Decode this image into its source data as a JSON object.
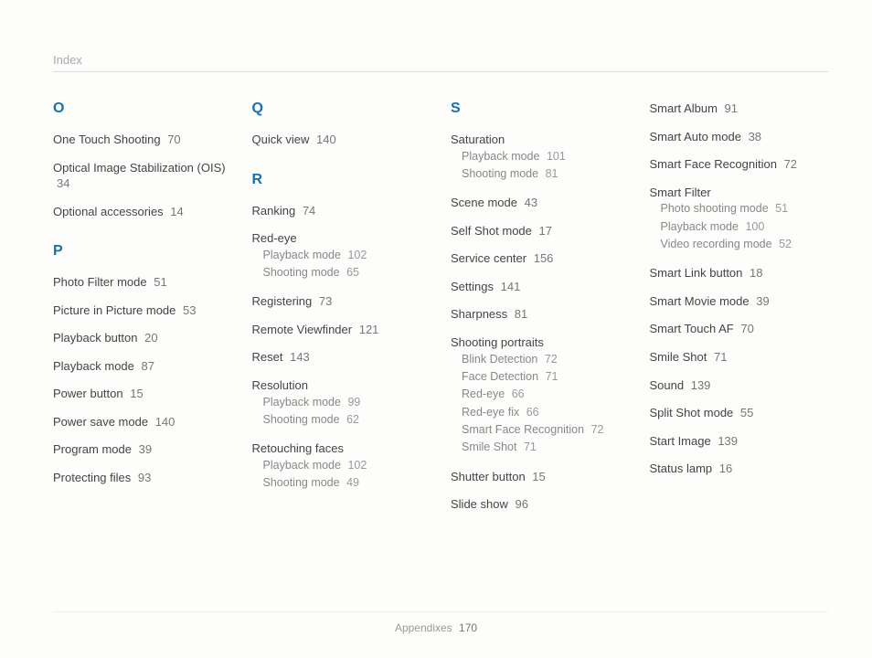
{
  "header": "Index",
  "footer": {
    "section": "Appendixes",
    "page": "170"
  },
  "columns": [
    {
      "groups": [
        {
          "letter": "O",
          "spaced": false,
          "entries": [
            {
              "term": "One Touch Shooting",
              "page": "70"
            },
            {
              "term": "Optical Image Stabilization (OIS)",
              "page": "34"
            },
            {
              "term": "Optional accessories",
              "page": "14"
            }
          ]
        },
        {
          "letter": "P",
          "spaced": true,
          "entries": [
            {
              "term": "Photo Filter mode",
              "page": "51"
            },
            {
              "term": "Picture in Picture mode",
              "page": "53"
            },
            {
              "term": "Playback button",
              "page": "20"
            },
            {
              "term": "Playback mode",
              "page": "87"
            },
            {
              "term": "Power button",
              "page": "15"
            },
            {
              "term": "Power save mode",
              "page": "140"
            },
            {
              "term": "Program mode",
              "page": "39"
            },
            {
              "term": "Protecting files",
              "page": "93"
            }
          ]
        }
      ]
    },
    {
      "groups": [
        {
          "letter": "Q",
          "spaced": false,
          "entries": [
            {
              "term": "Quick view",
              "page": "140"
            }
          ]
        },
        {
          "letter": "R",
          "spaced": true,
          "entries": [
            {
              "term": "Ranking",
              "page": "74"
            },
            {
              "term": "Red-eye",
              "subs": [
                {
                  "term": "Playback mode",
                  "page": "102"
                },
                {
                  "term": "Shooting mode",
                  "page": "65"
                }
              ]
            },
            {
              "term": "Registering",
              "page": "73"
            },
            {
              "term": "Remote Viewfinder",
              "page": "121"
            },
            {
              "term": "Reset",
              "page": "143"
            },
            {
              "term": "Resolution",
              "subs": [
                {
                  "term": "Playback mode",
                  "page": "99"
                },
                {
                  "term": "Shooting mode",
                  "page": "62"
                }
              ]
            },
            {
              "term": "Retouching faces",
              "subs": [
                {
                  "term": "Playback mode",
                  "page": "102"
                },
                {
                  "term": "Shooting mode",
                  "page": "49"
                }
              ]
            }
          ]
        }
      ]
    },
    {
      "groups": [
        {
          "letter": "S",
          "spaced": false,
          "entries": [
            {
              "term": "Saturation",
              "subs": [
                {
                  "term": "Playback mode",
                  "page": "101"
                },
                {
                  "term": "Shooting mode",
                  "page": "81"
                }
              ]
            },
            {
              "term": "Scene mode",
              "page": "43"
            },
            {
              "term": "Self Shot mode",
              "page": "17"
            },
            {
              "term": "Service center",
              "page": "156"
            },
            {
              "term": "Settings",
              "page": "141"
            },
            {
              "term": "Sharpness",
              "page": "81"
            },
            {
              "term": "Shooting portraits",
              "subs": [
                {
                  "term": "Blink Detection",
                  "page": "72"
                },
                {
                  "term": "Face Detection",
                  "page": "71"
                },
                {
                  "term": "Red-eye",
                  "page": "66"
                },
                {
                  "term": "Red-eye fix",
                  "page": "66"
                },
                {
                  "term": "Smart Face Recognition",
                  "page": "72"
                },
                {
                  "term": "Smile Shot",
                  "page": "71"
                }
              ]
            },
            {
              "term": "Shutter button",
              "page": "15"
            },
            {
              "term": "Slide show",
              "page": "96"
            }
          ]
        }
      ]
    },
    {
      "groups": [
        {
          "letter": "",
          "spaced": false,
          "entries": [
            {
              "term": "Smart Album",
              "page": "91"
            },
            {
              "term": "Smart Auto mode",
              "page": "38"
            },
            {
              "term": "Smart Face Recognition",
              "page": "72"
            },
            {
              "term": "Smart Filter",
              "subs": [
                {
                  "term": "Photo shooting mode",
                  "page": "51"
                },
                {
                  "term": "Playback mode",
                  "page": "100"
                },
                {
                  "term": "Video recording mode",
                  "page": "52"
                }
              ]
            },
            {
              "term": "Smart Link button",
              "page": "18"
            },
            {
              "term": "Smart Movie mode",
              "page": "39"
            },
            {
              "term": "Smart Touch AF",
              "page": "70"
            },
            {
              "term": "Smile Shot",
              "page": "71"
            },
            {
              "term": "Sound",
              "page": "139"
            },
            {
              "term": "Split Shot mode",
              "page": "55"
            },
            {
              "term": "Start Image",
              "page": "139"
            },
            {
              "term": "Status lamp",
              "page": "16"
            }
          ]
        }
      ]
    }
  ]
}
